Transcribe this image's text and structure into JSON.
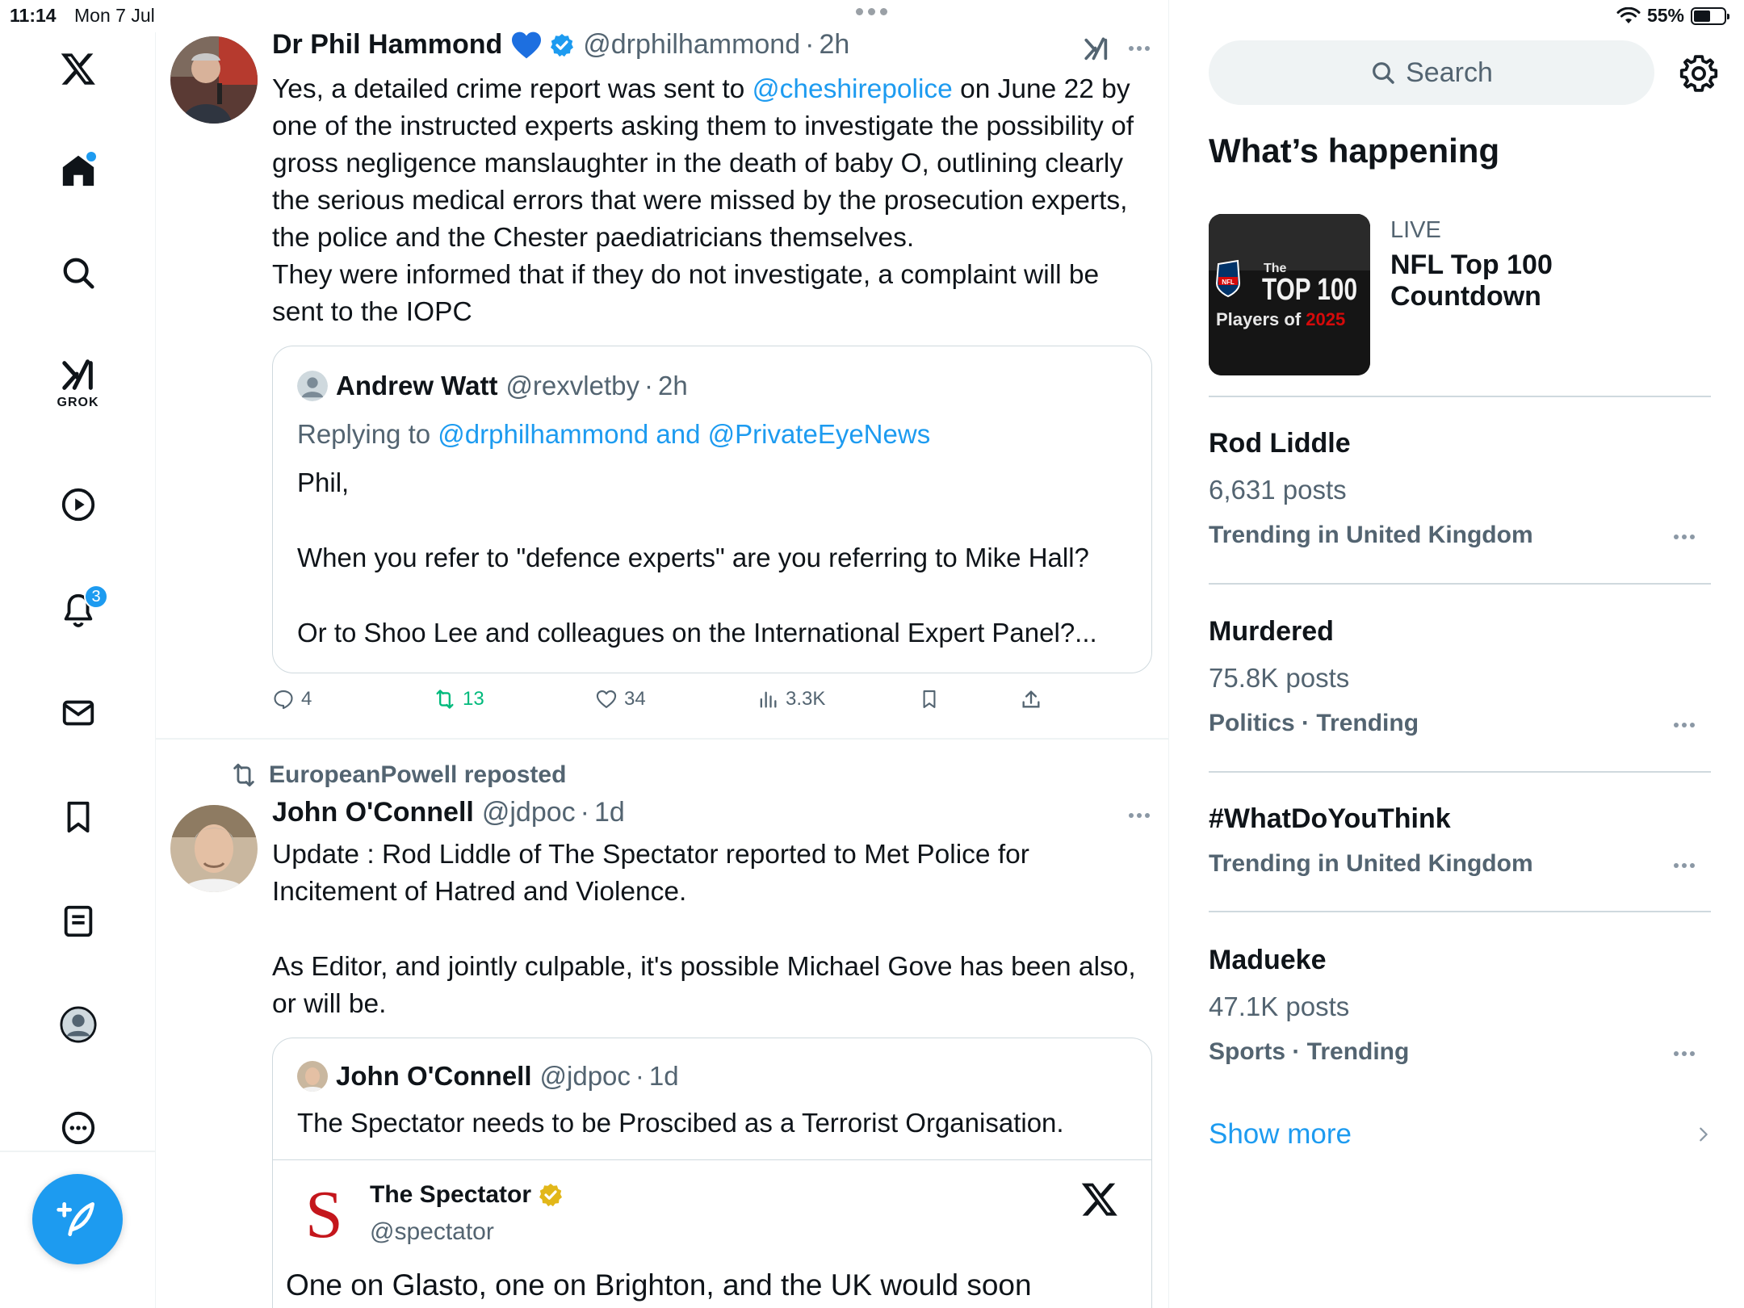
{
  "status_bar": {
    "time": "11:14",
    "date": "Mon 7 Jul",
    "battery": "55%",
    "battery_level": 0.55
  },
  "nav": {
    "grok_label": "GROK",
    "notification_count": "3",
    "items": [
      "x-logo",
      "home",
      "search",
      "grok",
      "video",
      "notifications",
      "messages",
      "bookmarks",
      "lists",
      "profile",
      "more"
    ]
  },
  "tweets": [
    {
      "author": "Dr Phil Hammond",
      "handle": "@drphilhammond",
      "sep": "·",
      "time": "2h",
      "text_parts": {
        "before": "Yes, a detailed crime report was sent to ",
        "mention": "@cheshirepolice",
        "after": " on June 22 by one of the instructed experts asking them to investigate the possibility of gross negligence manslaughter in the death of baby O, outlining clearly the serious medical errors that were missed by the prosecution experts, the police and the Chester paediatricians themselves.",
        "line2": "They were informed that if they do not investigate, a complaint will be sent to the IOPC"
      },
      "quote": {
        "author": "Andrew Watt",
        "handle": "@rexvletby",
        "sep": "·",
        "time": "2h",
        "replying_prefix": "Replying to ",
        "replying_to": "@drphilhammond and @PrivateEyeNews",
        "para1": "Phil,",
        "para2": "When you refer to \"defence experts\" are you referring to Mike Hall?",
        "para3": "Or to Shoo Lee and colleagues on the International Expert Panel?..."
      },
      "actions": {
        "replies": "4",
        "reposts": "13",
        "likes": "34",
        "views": "3.3K"
      }
    },
    {
      "repost_label": "EuropeanPowell reposted",
      "author": "John O'Connell",
      "handle": "@jdpoc",
      "sep": "·",
      "time": "1d",
      "para1": "Update : Rod Liddle of The Spectator reported to Met Police for Incitement of Hatred and Violence.",
      "para2": "As Editor, and jointly culpable, it's possible Michael Gove has been also, or will be.",
      "quote": {
        "author": "John O'Connell",
        "handle": "@jdpoc",
        "sep": "·",
        "time": "1d",
        "text": "The Spectator needs to be Proscibed as a Terrorist Organisation.",
        "embed": {
          "logo_letter": "S",
          "name": "The Spectator",
          "handle": "@spectator",
          "text": "One on Glasto, one on Brighton, and the UK would soon"
        }
      }
    }
  ],
  "sidebar": {
    "search_placeholder": "Search",
    "heading": "What’s happening",
    "live": {
      "label": "LIVE",
      "title": "NFL Top 100 Countdown",
      "thumb_lines": {
        "nfl": "NFL",
        "the": "The",
        "top": "TOP 100",
        "players": "Players of ",
        "year": "2025"
      }
    },
    "trends": [
      {
        "name": "Rod Liddle",
        "posts": "6,631 posts",
        "context": "Trending in United Kingdom"
      },
      {
        "name": "Murdered",
        "posts": "75.8K posts",
        "context": "Politics · Trending"
      },
      {
        "name": "#WhatDoYouThink",
        "posts": "",
        "context": "Trending in United Kingdom"
      },
      {
        "name": "Madueke",
        "posts": "47.1K posts",
        "context": "Sports · Trending"
      }
    ],
    "show_more": "Show more"
  },
  "colors": {
    "accent": "#1d9bf0",
    "repost_green": "#00ba7c",
    "text_secondary": "#536471",
    "verified_gold": "#e2b719"
  }
}
